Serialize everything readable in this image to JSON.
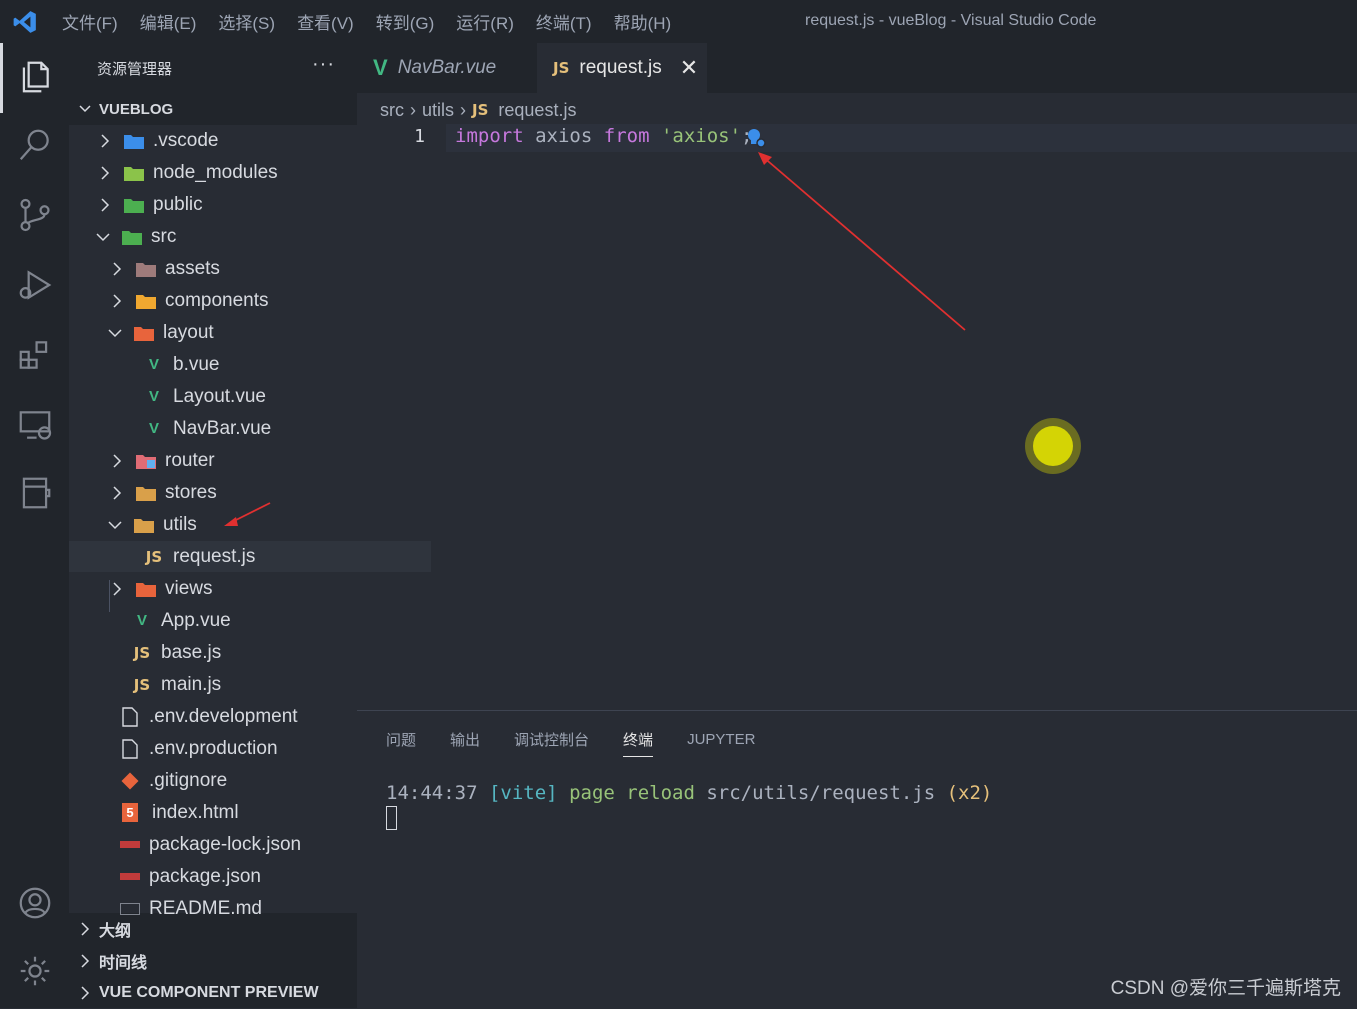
{
  "menu": [
    "文件(F)",
    "编辑(E)",
    "选择(S)",
    "查看(V)",
    "转到(G)",
    "运行(R)",
    "终端(T)",
    "帮助(H)"
  ],
  "window_title": "request.js - vueBlog - Visual Studio Code",
  "sidebar": {
    "header": "资源管理器",
    "more": "···",
    "project": "VUEBLOG",
    "tree": [
      {
        "label": ".vscode"
      },
      {
        "label": "node_modules"
      },
      {
        "label": "public"
      },
      {
        "label": "src"
      },
      {
        "label": "assets"
      },
      {
        "label": "components"
      },
      {
        "label": "layout"
      },
      {
        "label": "b.vue"
      },
      {
        "label": "Layout.vue"
      },
      {
        "label": "NavBar.vue"
      },
      {
        "label": "router"
      },
      {
        "label": "stores"
      },
      {
        "label": "utils"
      },
      {
        "label": "request.js"
      },
      {
        "label": "views"
      },
      {
        "label": "App.vue"
      },
      {
        "label": "base.js"
      },
      {
        "label": "main.js"
      },
      {
        "label": ".env.development"
      },
      {
        "label": ".env.production"
      },
      {
        "label": ".gitignore"
      },
      {
        "label": "index.html"
      },
      {
        "label": "package-lock.json"
      },
      {
        "label": "package.json"
      },
      {
        "label": "README.md"
      }
    ],
    "sections": [
      "大纲",
      "时间线",
      "VUE COMPONENT PREVIEW"
    ]
  },
  "tabs": {
    "navbar": {
      "icon": "V",
      "label": "NavBar.vue"
    },
    "request": {
      "icon": "JS",
      "label": "request.js",
      "close": "✕"
    }
  },
  "breadcrumb": {
    "part1": "src",
    "part2": "utils",
    "icon": "JS",
    "file": "request.js",
    "sep": "›"
  },
  "editor": {
    "line_number": "1",
    "tokens": {
      "import": "import",
      "ident": "axios",
      "from": "from",
      "str": "'axios'",
      "semi": ";"
    }
  },
  "panel": {
    "tabs": [
      "问题",
      "输出",
      "调试控制台",
      "终端",
      "JUPYTER"
    ],
    "terminal": {
      "time": "14:44:37",
      "tag": "[vite]",
      "msg": "page reload",
      "path": "src/utils/request.js",
      "count": "(x2)"
    }
  },
  "icons": {
    "js": "JS",
    "vue": "V",
    "html": "5"
  },
  "colors": {
    "accent": "#42b883",
    "js": "#e5c07b",
    "annotation": "#e03030"
  },
  "watermark": "CSDN @爱你三千遍斯塔克"
}
